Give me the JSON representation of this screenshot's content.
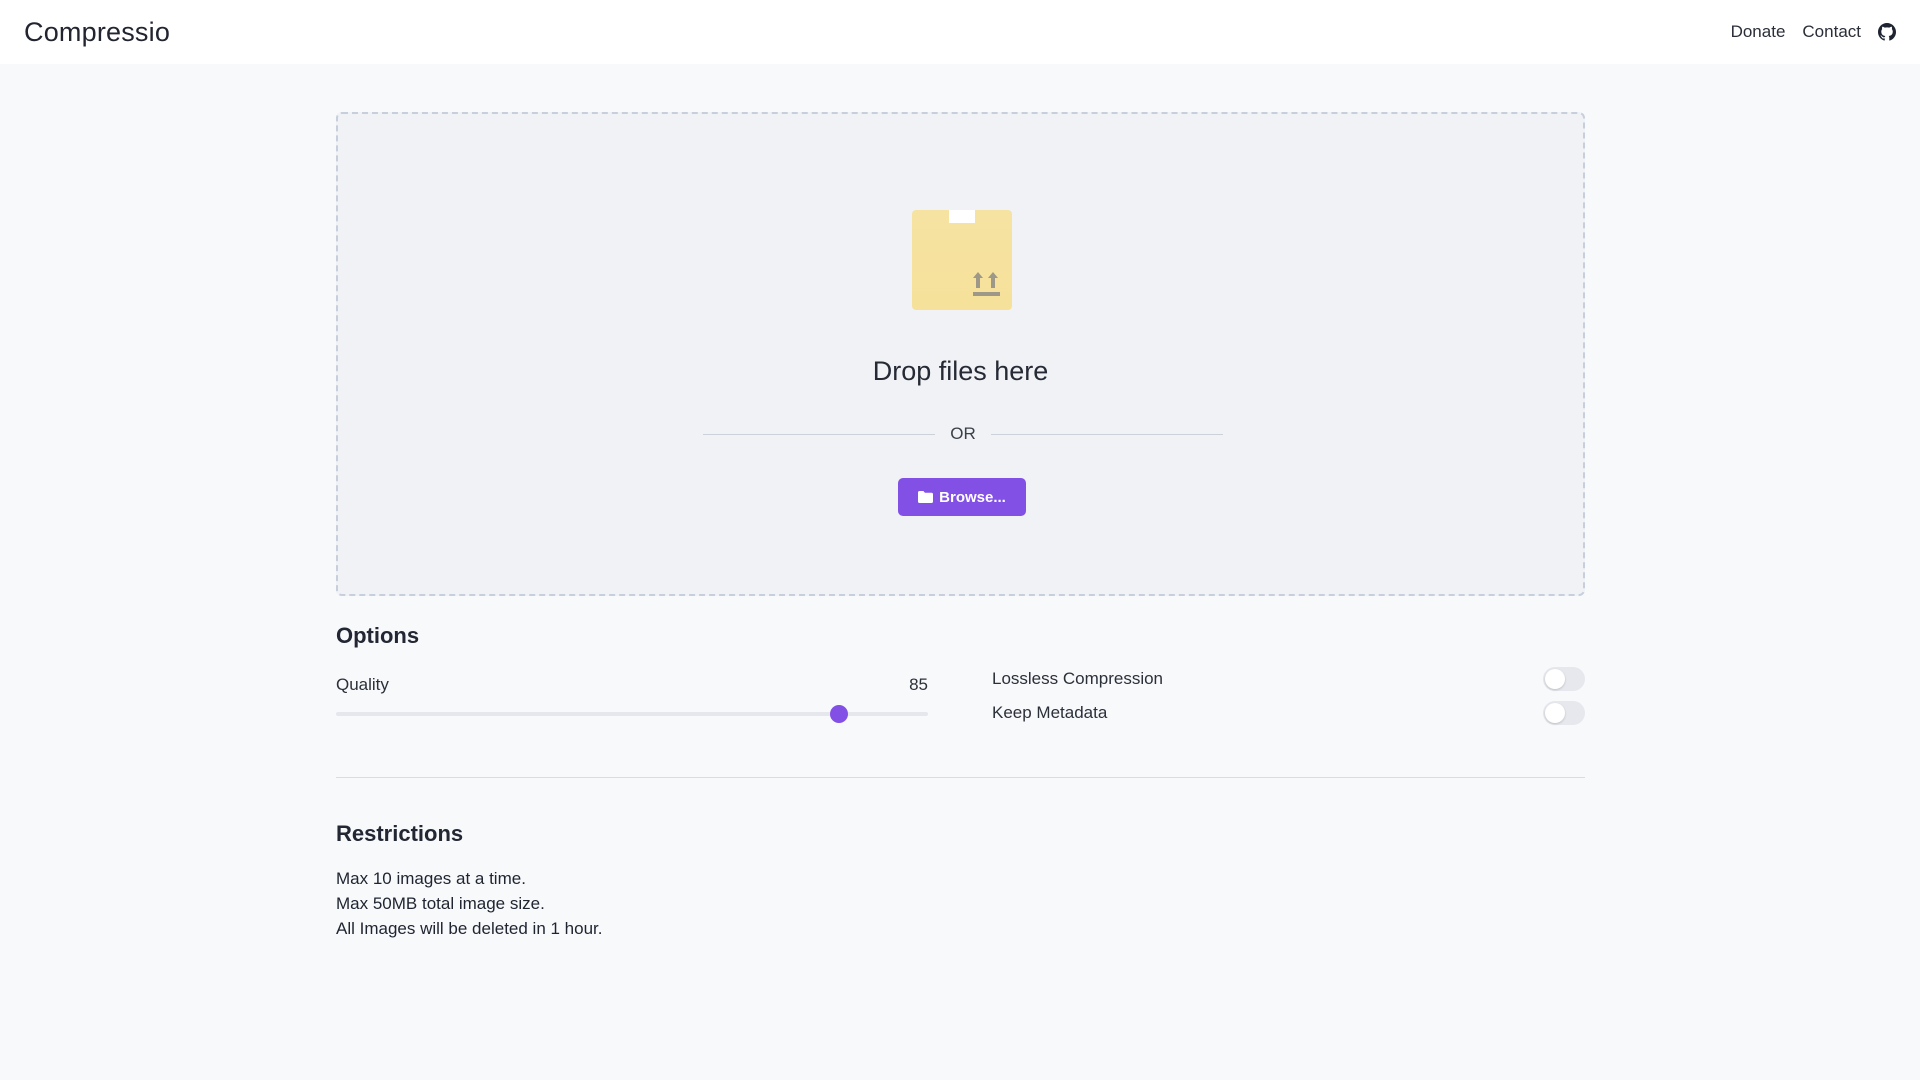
{
  "navbar": {
    "brand": "Compressio",
    "links": [
      "Donate",
      "Contact"
    ],
    "icon": "github-icon"
  },
  "upload": {
    "icon": "box-upload-icon",
    "drop_text": "Drop files here",
    "or_text": "OR",
    "browse_label": "Browse...",
    "browse_icon": "folder-icon"
  },
  "options": {
    "title": "Options",
    "quality": {
      "label": "Quality",
      "value": 85,
      "value_text": "85",
      "min": 0,
      "max": 100
    },
    "toggles": [
      {
        "label": "Lossless Compression",
        "enabled": false
      },
      {
        "label": "Keep Metadata",
        "enabled": false
      }
    ]
  },
  "restrictions": {
    "title": "Restrictions",
    "items": [
      "Max 10 images at a time.",
      "Max 50MB total image size.",
      "All Images will be deleted in 1 hour."
    ]
  },
  "colors": {
    "accent": "#8250e5",
    "background": "#f8f9fb",
    "dropzone_bg": "#f0f2f6",
    "box_icon": "#f6e3a2"
  }
}
